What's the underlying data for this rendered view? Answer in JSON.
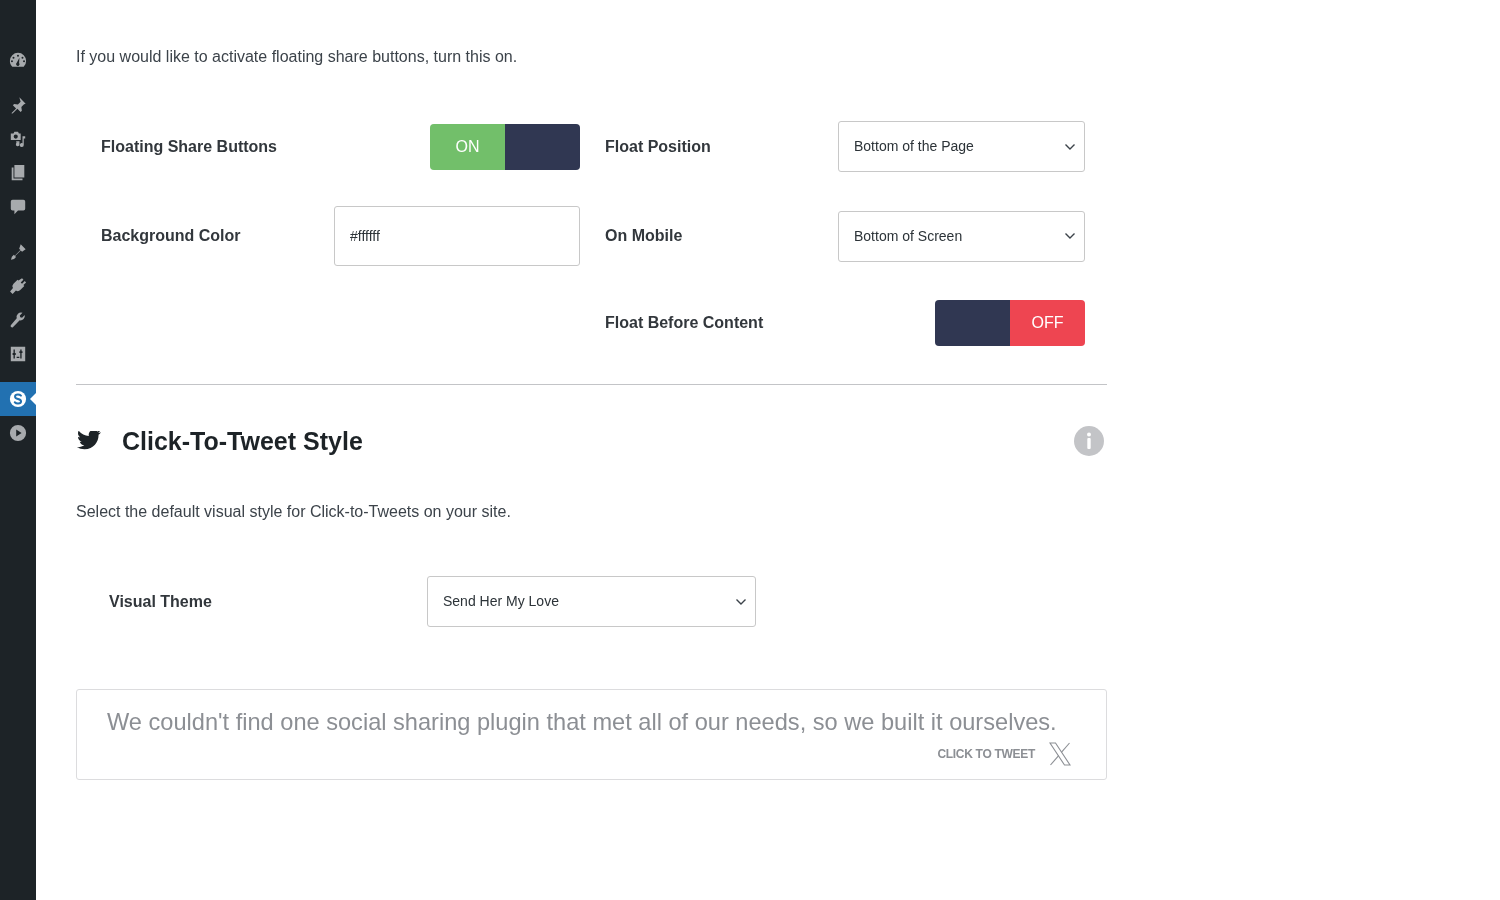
{
  "sidebar": {
    "groups": [
      {
        "items": [
          {
            "selected": false
          }
        ]
      },
      {
        "items": [
          {
            "selected": false
          },
          {
            "selected": false
          },
          {
            "selected": false
          },
          {
            "selected": false
          }
        ]
      },
      {
        "items": [
          {
            "selected": false
          },
          {
            "selected": false
          },
          {
            "selected": false
          },
          {
            "selected": false
          }
        ]
      },
      {
        "items": [
          {
            "selected": true
          },
          {
            "selected": false
          }
        ]
      }
    ]
  },
  "floating_section": {
    "description": "If you would like to activate floating share buttons, turn this on.",
    "columns": [
      {
        "fields": [
          {
            "kind": "toggle",
            "label": "Floating Share Buttons",
            "on": true,
            "state_text": "ON"
          },
          {
            "kind": "text",
            "label": "Background Color",
            "value": "#ffffff"
          }
        ]
      },
      {
        "fields": [
          {
            "kind": "select",
            "label": "Float Position",
            "value": "Bottom of the Page"
          },
          {
            "kind": "select",
            "label": "On Mobile",
            "value": "Bottom of Screen"
          },
          {
            "kind": "toggle",
            "label": "Float Before Content",
            "on": false,
            "state_text": "OFF"
          }
        ]
      }
    ]
  },
  "click_to_tweet_section": {
    "title": "Click-To-Tweet Style",
    "description": "Select the default visual style for Click-to-Tweets on your site.",
    "fields": [
      {
        "kind": "select",
        "label": "Visual Theme",
        "value": "Send Her My Love"
      }
    ],
    "preview": {
      "quote": "We couldn't find one social sharing plugin that met all of our needs, so we built it ourselves.",
      "action": "CLICK TO TWEET"
    }
  }
}
